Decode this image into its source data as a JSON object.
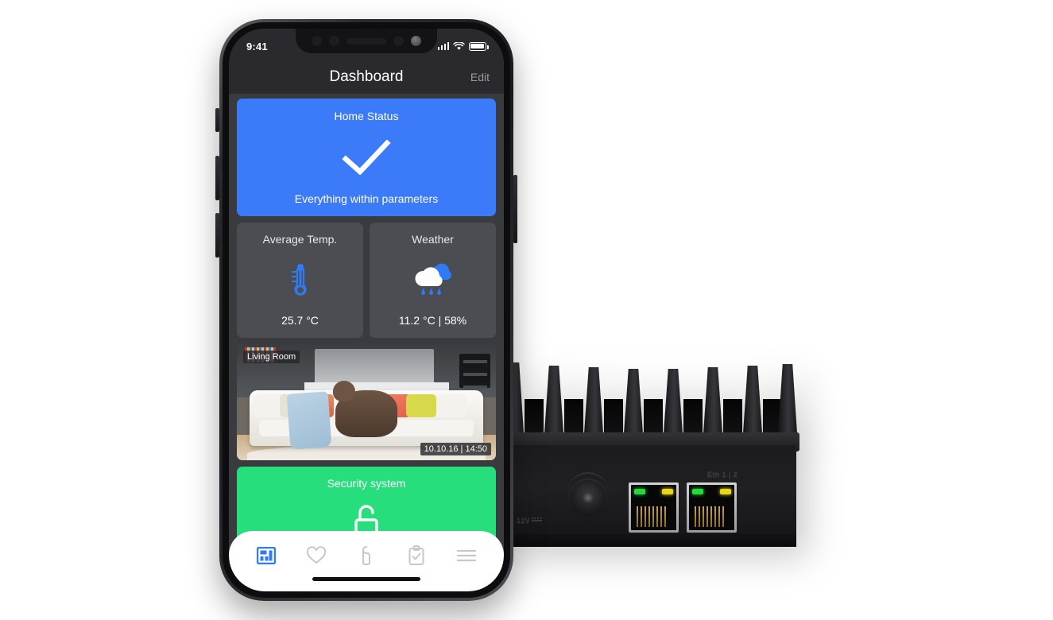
{
  "phone": {
    "status_bar": {
      "time": "9:41",
      "signal_icon": "cellular-bars-icon",
      "wifi_icon": "wifi-icon",
      "battery_icon": "battery-full-icon"
    },
    "nav_bar": {
      "title": "Dashboard",
      "edit_label": "Edit"
    },
    "home_indicator": "home-indicator"
  },
  "cards": {
    "home_status": {
      "title": "Home Status",
      "icon": "checkmark-icon",
      "subtitle": "Everything within parameters",
      "color": "#3b7bfa"
    },
    "average_temp": {
      "title": "Average Temp.",
      "icon": "thermometer-icon",
      "value": "25.7 °C",
      "color": "#4c4d52"
    },
    "weather": {
      "title": "Weather",
      "icon": "rain-cloud-icon",
      "value": "11.2 °C | 58%",
      "color": "#4c4d52"
    },
    "camera": {
      "room_label": "Living Room",
      "timestamp": "10.10.16 | 14:50"
    },
    "security": {
      "title": "Security system",
      "icon": "unlocked-padlock-icon",
      "color": "#27de7d"
    }
  },
  "tab_bar": {
    "items": [
      {
        "name": "dashboard",
        "icon": "dashboard-layout-icon",
        "active": true
      },
      {
        "name": "favorites",
        "icon": "heart-icon",
        "active": false
      },
      {
        "name": "do-not-disturb",
        "icon": "door-hanger-icon",
        "active": false
      },
      {
        "name": "tasks",
        "icon": "clipboard-check-icon",
        "active": false
      },
      {
        "name": "menu",
        "icon": "hamburger-menu-icon",
        "active": false
      }
    ],
    "active_color": "#2f7bf6",
    "inactive_color": "#c7c7cc"
  },
  "device": {
    "power_label": "12V",
    "ethernet_label": "Eth 1 | 2",
    "ports": [
      {
        "name": "ethernet-port-1",
        "leds": [
          "green",
          "yellow"
        ]
      },
      {
        "name": "ethernet-port-2",
        "leds": [
          "green",
          "yellow"
        ]
      }
    ]
  }
}
